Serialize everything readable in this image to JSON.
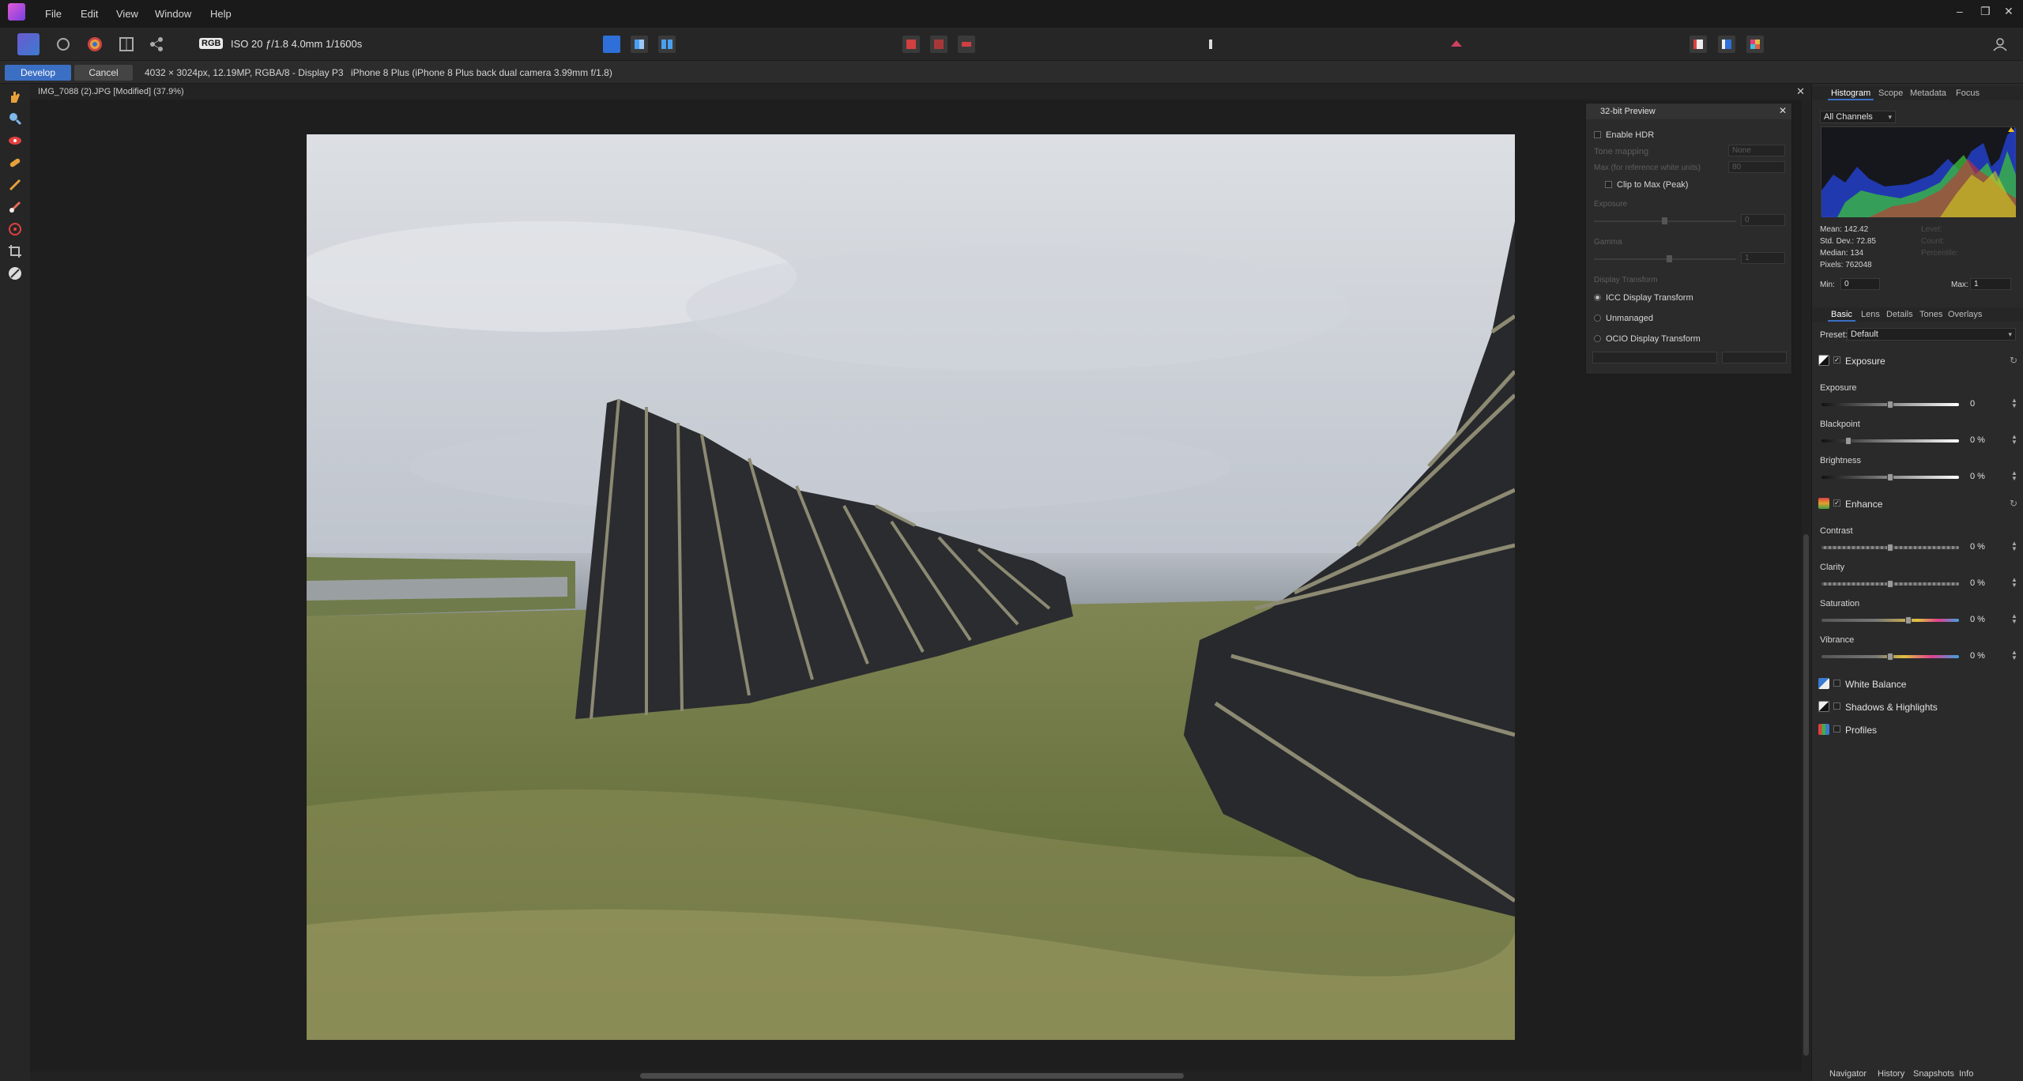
{
  "menubar": {
    "items": [
      "File",
      "Edit",
      "View",
      "Window",
      "Help"
    ],
    "window_controls": [
      "–",
      "❐",
      "✕"
    ]
  },
  "toolbar": {
    "badge": "RGB",
    "exif": "ISO 20 ƒ/1.8 4.0mm 1/1600s"
  },
  "context": {
    "develop_label": "Develop",
    "cancel_label": "Cancel",
    "image_info": "4032 × 3024px, 12.19MP, RGBA/8 - Display P3",
    "camera_info": "iPhone 8 Plus (iPhone 8 Plus back dual camera 3.99mm f/1.8)"
  },
  "document": {
    "title": "IMG_7088 (2).JPG [Modified] (37.9%)",
    "close": "✕"
  },
  "preview32": {
    "title": "32-bit Preview",
    "close": "✕",
    "enable_hdr": "Enable HDR",
    "tone_mapping": "Tone mapping",
    "tone_mapping_value": "None",
    "max_white": "Max (for reference white units)",
    "max_white_value": "80",
    "clip_to_max": "Clip to Max (Peak)",
    "exposure_label": "Exposure",
    "exposure_value": "0",
    "gamma_label": "Gamma",
    "gamma_value": "1",
    "display_transform_label": "Display Transform",
    "icc": "ICC Display Transform",
    "unmanaged": "Unmanaged",
    "ocio": "OCIO Display Transform"
  },
  "histogram_panel": {
    "tabs": [
      "Histogram",
      "Scope",
      "Metadata",
      "Focus"
    ],
    "active_tab": 0,
    "channel": "All Channels",
    "stats": [
      "Mean: 142.42",
      "Std. Dev.: 72.85",
      "Median: 134",
      "Pixels: 762048"
    ],
    "stats_dim": [
      "Level:",
      "Count:",
      "Percentile:"
    ],
    "min_label": "Min:",
    "min_value": "0",
    "max_label": "Max:",
    "max_value": "1"
  },
  "develop_panel": {
    "tabs": [
      "Basic",
      "Lens",
      "Details",
      "Tones",
      "Overlays"
    ],
    "active_tab": 0,
    "preset_label": "Preset:",
    "preset_value": "Default",
    "sections": {
      "exposure": "Exposure",
      "enhance": "Enhance",
      "white_balance": "White Balance",
      "shadows_highlights": "Shadows & Highlights",
      "profiles": "Profiles"
    },
    "adjustments": {
      "exposure": {
        "label": "Exposure",
        "value": "0",
        "level": 0.5
      },
      "blackpoint": {
        "label": "Blackpoint",
        "value": "0 %",
        "level": 0.0
      },
      "brightness": {
        "label": "Brightness",
        "value": "0 %",
        "level": 0.5
      },
      "contrast": {
        "label": "Contrast",
        "value": "0 %",
        "level": 0.5
      },
      "clarity": {
        "label": "Clarity",
        "value": "0 %",
        "level": 0.5
      },
      "saturation": {
        "label": "Saturation",
        "value": "0 %",
        "level": 0.5
      },
      "vibrance": {
        "label": "Vibrance",
        "value": "0 %",
        "level": 0.5
      }
    }
  },
  "footer_tabs": [
    "Navigator",
    "History",
    "Snapshots",
    "Info"
  ],
  "colors": {
    "accent": "#3b6fc4",
    "panel": "#2a2a2a",
    "canvas": "#1e1e1e"
  }
}
